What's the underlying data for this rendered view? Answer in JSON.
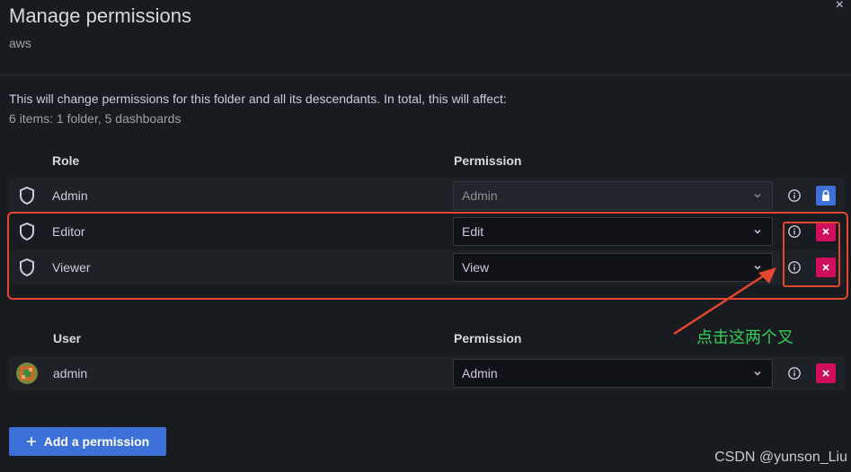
{
  "modal": {
    "title": "Manage permissions",
    "subtitle": "aws",
    "close_label": "×"
  },
  "info": {
    "line1": "This will change permissions for this folder and all its descendants. In total, this will affect:",
    "line2": "6 items: 1 folder, 5 dashboards"
  },
  "roles_section": {
    "col_role": "Role",
    "col_permission": "Permission",
    "rows": [
      {
        "name": "Admin",
        "permission": "Admin",
        "disabled": true,
        "action": "lock"
      },
      {
        "name": "Editor",
        "permission": "Edit",
        "disabled": false,
        "action": "remove"
      },
      {
        "name": "Viewer",
        "permission": "View",
        "disabled": false,
        "action": "remove"
      }
    ]
  },
  "users_section": {
    "col_user": "User",
    "col_permission": "Permission",
    "rows": [
      {
        "name": "admin",
        "permission": "Admin",
        "action": "remove"
      }
    ]
  },
  "add_button": {
    "label": "Add a permission",
    "icon": "plus-icon"
  },
  "annotation": {
    "text": "点击这两个叉"
  },
  "watermark": {
    "text": "CSDN @yunson_Liu"
  },
  "colors": {
    "background": "#181b1f",
    "primary": "#3d71d9",
    "danger": "#d10e5c",
    "annotation_red": "#e4452f",
    "annotation_green": "#2fd05a"
  }
}
